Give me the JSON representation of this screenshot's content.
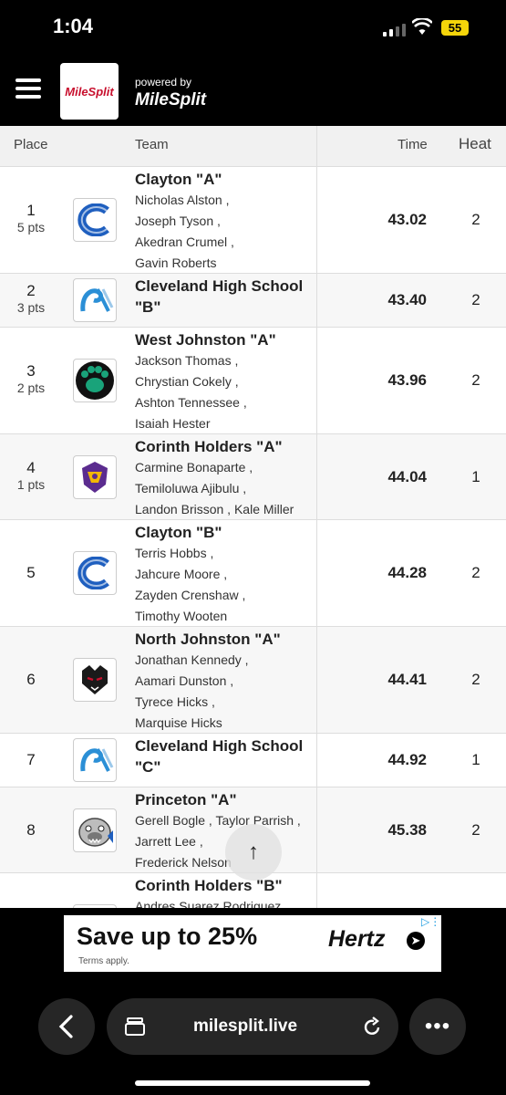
{
  "status": {
    "time": "1:04",
    "battery": "55"
  },
  "header": {
    "logo_text": "MileSplit",
    "powered_by": "powered by",
    "brand": "MileSplit"
  },
  "table": {
    "columns": {
      "place": "Place",
      "team": "Team",
      "time": "Time",
      "heat": "Heat"
    },
    "rows": [
      {
        "place": "1",
        "pts": "5 pts",
        "team": "Clayton \"A\"",
        "athletes": [
          "Nicholas Alston ,",
          "Joseph Tyson ,",
          "Akedran Crumel ,",
          "Gavin Roberts"
        ],
        "time": "43.02",
        "heat": "2",
        "logo": "clayton"
      },
      {
        "place": "2",
        "pts": "3 pts",
        "team": "Cleveland High School \"B\"",
        "athletes": [],
        "time": "43.40",
        "heat": "2",
        "logo": "cleveland"
      },
      {
        "place": "3",
        "pts": "2 pts",
        "team": "West Johnston \"A\"",
        "athletes": [
          "Jackson Thomas ,",
          "Chrystian Cokely ,",
          "Ashton Tennessee ,",
          "Isaiah Hester"
        ],
        "time": "43.96",
        "heat": "2",
        "logo": "westjohnston"
      },
      {
        "place": "4",
        "pts": "1 pts",
        "team": "Corinth Holders \"A\"",
        "athletes": [
          "Carmine Bonaparte ,",
          "Temiloluwa Ajibulu ,",
          "Landon Brisson , Kale Miller"
        ],
        "time": "44.04",
        "heat": "1",
        "logo": "corinth"
      },
      {
        "place": "5",
        "pts": "",
        "team": "Clayton \"B\"",
        "athletes": [
          "Terris Hobbs ,",
          "Jahcure Moore ,",
          "Zayden Crenshaw ,",
          "Timothy Wooten"
        ],
        "time": "44.28",
        "heat": "2",
        "logo": "clayton"
      },
      {
        "place": "6",
        "pts": "",
        "team": "North Johnston \"A\"",
        "athletes": [
          "Jonathan Kennedy ,",
          "Aamari Dunston ,",
          "Tyrece Hicks ,",
          "Marquise Hicks"
        ],
        "time": "44.41",
        "heat": "2",
        "logo": "northjohnston"
      },
      {
        "place": "7",
        "pts": "",
        "team": "Cleveland High School \"C\"",
        "athletes": [],
        "time": "44.92",
        "heat": "1",
        "logo": "cleveland"
      },
      {
        "place": "8",
        "pts": "",
        "team": "Princeton \"A\"",
        "athletes": [
          "Gerell Bogle , Taylor Parrish ,",
          "Jarrett Lee ,",
          "Frederick Nelson"
        ],
        "time": "45.38",
        "heat": "2",
        "logo": "princeton"
      },
      {
        "place": "",
        "pts": "",
        "team": "Corinth Holders \"B\"",
        "athletes": [
          "Andres Suarez Rodriguez ,"
        ],
        "time": "",
        "heat": "",
        "logo": "corinth"
      }
    ]
  },
  "scroll_top_icon": "up-arrow-icon",
  "ad": {
    "headline": "Save up to 25%",
    "terms": "Terms apply.",
    "brand": "Hertz"
  },
  "browser": {
    "url": "milesplit.live"
  },
  "colors": {
    "clayton_blue": "#1f5fbf",
    "cleveland_blue": "#2b8fd6",
    "westjohnston_green": "#19a37a",
    "corinth_purple": "#5b2c8f",
    "corinth_gold": "#f2b705",
    "milesplit_red": "#c8102e"
  }
}
